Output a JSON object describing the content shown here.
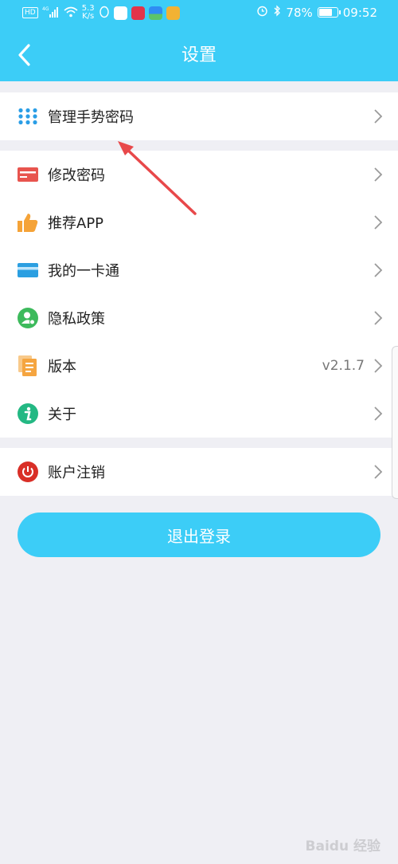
{
  "status_bar": {
    "network_tag": "HD",
    "signal_tag": "4G",
    "speed_value": "5.3",
    "speed_unit": "K/s",
    "battery": "78%",
    "battery_level": 0.78,
    "time": "09:52"
  },
  "header": {
    "title": "设置"
  },
  "groups": {
    "first": {
      "gesture": {
        "label": "管理手势密码"
      }
    },
    "second": {
      "change_password": {
        "label": "修改密码"
      },
      "recommend": {
        "label": "推荐APP"
      },
      "card": {
        "label": "我的一卡通"
      },
      "privacy": {
        "label": "隐私政策"
      },
      "version": {
        "label": "版本",
        "value": "v2.1.7"
      },
      "about": {
        "label": "关于"
      }
    },
    "third": {
      "cancel_account": {
        "label": "账户注销"
      }
    },
    "logout_label": "退出登录"
  },
  "watermark": "Baidu 经验",
  "colors": {
    "accent": "#3ccdf7",
    "background": "#efeff4",
    "annotation_arrow": "#e8484a"
  }
}
